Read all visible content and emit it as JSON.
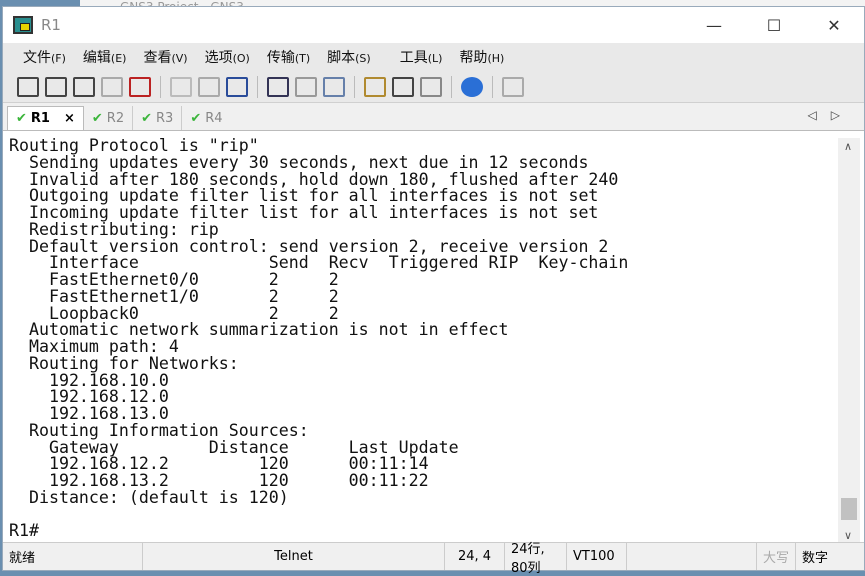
{
  "background_window": {
    "title": "GNS3 Project - GNS3 ..."
  },
  "window": {
    "title": "R1",
    "minimize": "—",
    "maximize": "☐",
    "close": "✕"
  },
  "menu": [
    {
      "label": "文件",
      "key": "(F)"
    },
    {
      "label": "编辑",
      "key": "(E)"
    },
    {
      "label": "查看",
      "key": "(V)"
    },
    {
      "label": "选项",
      "key": "(O)"
    },
    {
      "label": "传输",
      "key": "(T)"
    },
    {
      "label": "脚本",
      "key": "(S)"
    },
    {
      "label": "工具",
      "key": "(L)"
    },
    {
      "label": "帮助",
      "key": "(H)"
    }
  ],
  "toolbar": [
    "connect-icon",
    "quick-connect-icon",
    "connect-tab-icon",
    "reconnect-icon",
    "disconnect-icon",
    "copy-icon",
    "paste-icon",
    "find-icon",
    "print-setup-icon",
    "print-selection-icon",
    "print-icon",
    "session-options-icon",
    "keymap-icon",
    "key-icon",
    "help-icon",
    "lock-icon"
  ],
  "tabs": [
    {
      "label": "R1",
      "close": "×",
      "active": true
    },
    {
      "label": "R2"
    },
    {
      "label": "R3"
    },
    {
      "label": "R4"
    }
  ],
  "tab_nav": {
    "left": "◁",
    "right": "▷"
  },
  "terminal": {
    "lines": [
      "Routing Protocol is \"rip\"",
      "  Sending updates every 30 seconds, next due in 12 seconds",
      "  Invalid after 180 seconds, hold down 180, flushed after 240",
      "  Outgoing update filter list for all interfaces is not set",
      "  Incoming update filter list for all interfaces is not set",
      "  Redistributing: rip",
      "  Default version control: send version 2, receive version 2",
      "    Interface             Send  Recv  Triggered RIP  Key-chain",
      "    FastEthernet0/0       2     2",
      "    FastEthernet1/0       2     2",
      "    Loopback0             2     2",
      "  Automatic network summarization is not in effect",
      "  Maximum path: 4",
      "  Routing for Networks:",
      "    192.168.10.0",
      "    192.168.12.0",
      "    192.168.13.0",
      "  Routing Information Sources:",
      "    Gateway         Distance      Last Update",
      "    192.168.12.2         120      00:11:14",
      "    192.168.13.2         120      00:11:22",
      "  Distance: (default is 120)",
      "",
      "R1#"
    ]
  },
  "status": {
    "ready": "就绪",
    "protocol": "Telnet",
    "cursor": "24,  4",
    "size": "24行, 80列",
    "emulation": "VT100",
    "caps": "大写",
    "num": "数字"
  }
}
